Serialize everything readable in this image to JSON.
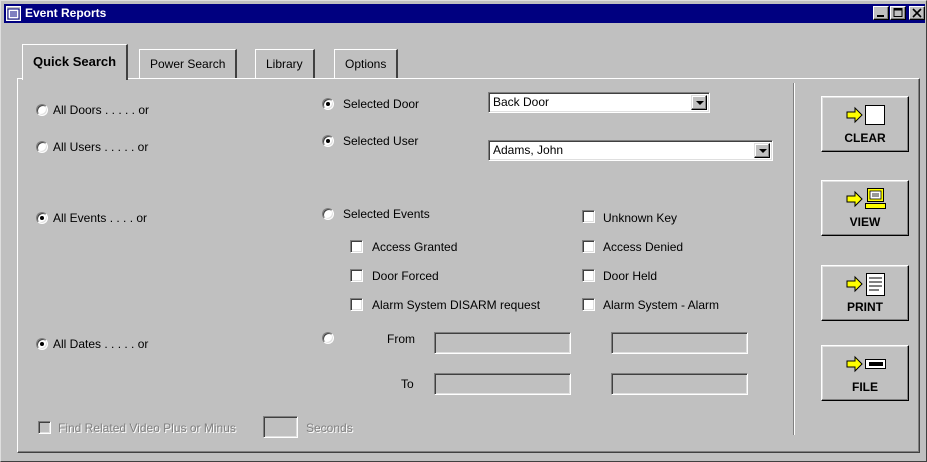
{
  "window": {
    "title": "Event Reports"
  },
  "tabs": [
    {
      "label": "Quick Search",
      "active": true
    },
    {
      "label": "Power Search",
      "active": false
    },
    {
      "label": "Library",
      "active": false
    },
    {
      "label": "Options",
      "active": false
    }
  ],
  "doors": {
    "all_label": "All Doors . . . . .   or",
    "selected_label": "Selected Door",
    "selected_value": "Back Door",
    "mode": "selected"
  },
  "users": {
    "all_label": "All Users . . . . .   or",
    "selected_label": "Selected User",
    "selected_value": "Adams, John",
    "mode": "selected"
  },
  "events": {
    "all_label": "All Events . . . .   or",
    "selected_label": "Selected Events",
    "mode": "all",
    "options": [
      {
        "label": "Unknown Key",
        "checked": false
      },
      {
        "label": "Access Granted",
        "checked": false
      },
      {
        "label": "Access Denied",
        "checked": false
      },
      {
        "label": "Door Forced",
        "checked": false
      },
      {
        "label": "Door Held",
        "checked": false
      },
      {
        "label": "Alarm System DISARM request",
        "checked": false
      },
      {
        "label": "Alarm System - Alarm",
        "checked": false
      }
    ]
  },
  "dates": {
    "all_label": "All Dates . . . . .   or",
    "mode": "all",
    "from_label": "From",
    "to_label": "To",
    "from_date": "",
    "from_time": "",
    "to_date": "",
    "to_time": ""
  },
  "video": {
    "label": "Find Related Video Plus or Minus",
    "seconds_label": "Seconds",
    "value": "",
    "enabled": false
  },
  "actions": [
    {
      "label": "CLEAR",
      "icon": "clear-icon"
    },
    {
      "label": "VIEW",
      "icon": "view-icon"
    },
    {
      "label": "PRINT",
      "icon": "print-icon"
    },
    {
      "label": "FILE",
      "icon": "file-icon"
    }
  ],
  "colors": {
    "titlebar": "#000080",
    "face": "#c0c0c0",
    "arrow": "#ffff00"
  }
}
